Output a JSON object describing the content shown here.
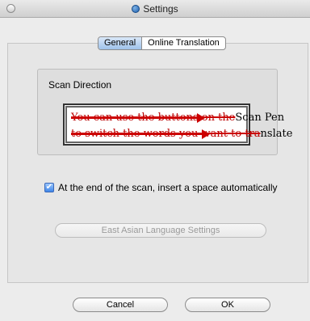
{
  "window": {
    "title": "Settings",
    "app_icon": "settings-app-icon"
  },
  "tabs": [
    {
      "label": "General",
      "active": true
    },
    {
      "label": "Online Translation",
      "active": false
    }
  ],
  "scan_direction": {
    "label": "Scan Direction",
    "demo_line1_strike": "You can use the buttons on the",
    "demo_line1_end": "Scan Pen",
    "demo_line2_strike": "to switch the words you want to tra",
    "demo_line2_end": "nslate"
  },
  "options": {
    "auto_space_label": "At the end of the scan, insert a space automatically",
    "auto_space_checked": true
  },
  "east_asian_button": "East Asian Language Settings",
  "footer": {
    "cancel_label": "Cancel",
    "ok_label": "OK"
  },
  "colors": {
    "accent": "#3f86e8",
    "strike_red": "#c00000"
  }
}
